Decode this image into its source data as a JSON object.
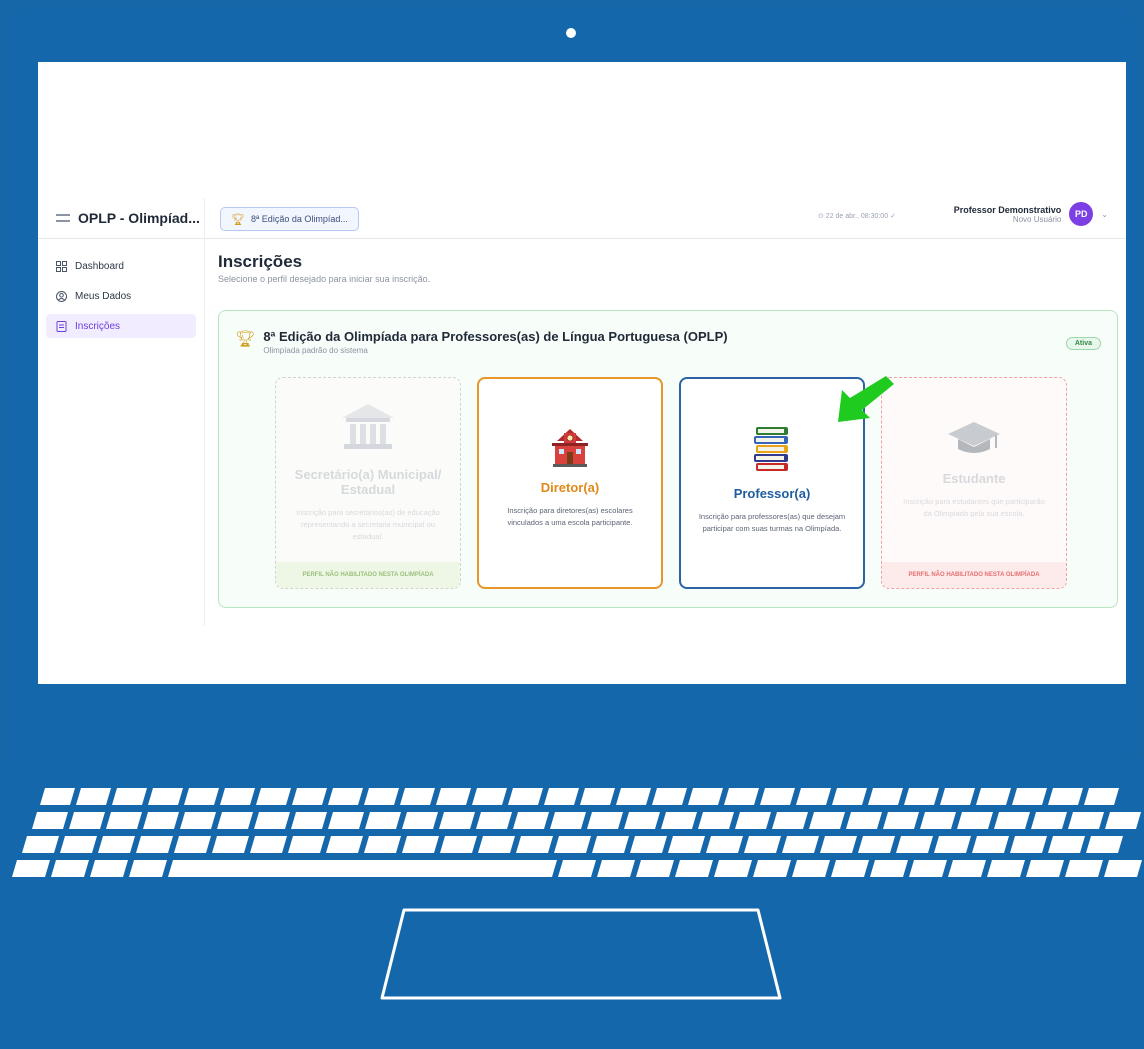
{
  "app": {
    "brand": "OPLP - Olimpíad...",
    "edition_pill": "8ª Edição da Olimpíad...",
    "datetime": "⊙ 22 de abr., 08:30:00 ✓",
    "user": {
      "name": "Professor Demonstrativo",
      "role": "Novo Usuário",
      "initials": "PD"
    }
  },
  "sidebar": {
    "items": [
      {
        "label": "Dashboard",
        "icon": "dashboard-icon",
        "active": false
      },
      {
        "label": "Meus Dados",
        "icon": "user-circle-icon",
        "active": false
      },
      {
        "label": "Inscrições",
        "icon": "document-icon",
        "active": true
      }
    ]
  },
  "main": {
    "title": "Inscrições",
    "subtitle": "Selecione o perfil desejado para iniciar sua inscrição.",
    "olympiad": {
      "title": "8ª Edição da Olimpíada para Professores(as) de Língua Portuguesa (OPLP)",
      "subtitle": "Olimpíada padrão do sistema",
      "status": "Ativa"
    },
    "cards": [
      {
        "title": "Secretário(a) Municipal/ Estadual",
        "desc": "Inscrição para secretários(as) de educação representando a secretaria municipal ou estadual.",
        "banner": "PERFIL NÃO HABILITADO NESTA OLIMPÍADA",
        "icon": "bank-building-icon",
        "enabled": false
      },
      {
        "title": "Diretor(a)",
        "desc": "Inscrição para diretores(as) escolares vinculados a uma escola participante.",
        "icon": "school-icon",
        "enabled": true
      },
      {
        "title": "Professor(a)",
        "desc": "Inscrição para professores(as) que desejam participar com suas turmas na Olimpíada.",
        "icon": "books-icon",
        "enabled": true
      },
      {
        "title": "Estudante",
        "desc": "Inscrição para estudantes que participarão da Olimpíada pela sua escola.",
        "banner": "PERFIL NÃO HABILITADO NESTA OLIMPÍADA",
        "icon": "graduation-cap-icon",
        "enabled": false
      }
    ]
  },
  "colors": {
    "laptop": "#1567ab",
    "accent_purple": "#6d3fe0",
    "director_orange": "#e8962a",
    "teacher_blue": "#2d63a6",
    "arrow_green": "#1fcb1f"
  }
}
